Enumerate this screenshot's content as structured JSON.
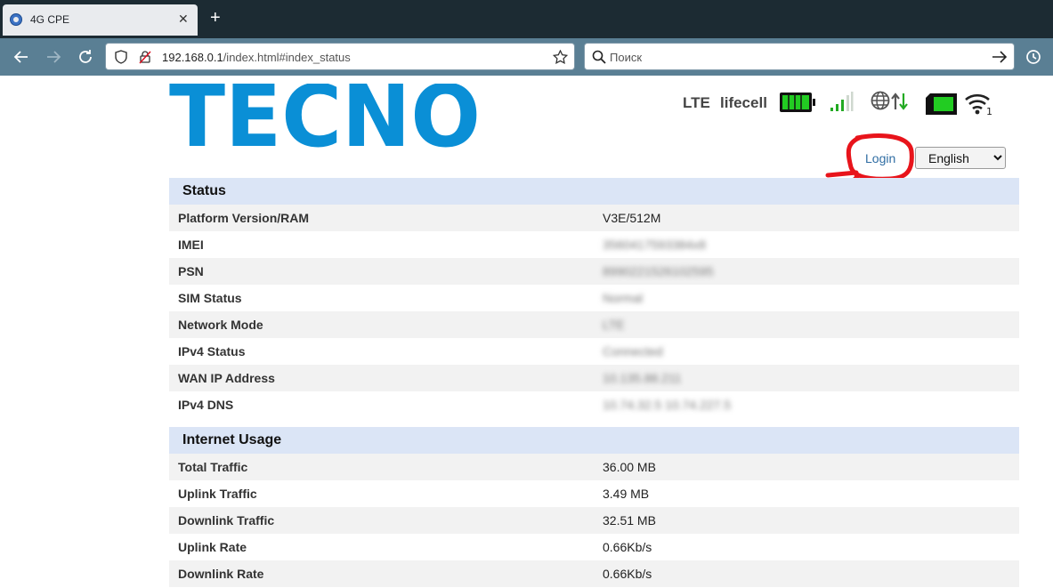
{
  "browser": {
    "tab_title": "4G CPE",
    "url_host": "192.168.0.1",
    "url_path": "/index.html#index_status",
    "search_placeholder": "Поиск"
  },
  "header": {
    "brand": "TECNO",
    "network_type": "LTE",
    "operator": "lifecell",
    "wifi_clients": "1",
    "colors": {
      "brand_blue": "#0a8fd6",
      "battery_green": "#22cc22"
    }
  },
  "controls": {
    "login_label": "Login",
    "language": "English"
  },
  "status": {
    "title": "Status",
    "rows": [
      {
        "label": "Platform Version/RAM",
        "value": "V3E/512M"
      },
      {
        "label": "IMEI",
        "value": "3560417593384x8"
      },
      {
        "label": "PSN",
        "value": "8990221526102595"
      },
      {
        "label": "SIM Status",
        "value": "Normal"
      },
      {
        "label": "Network Mode",
        "value": "LTE"
      },
      {
        "label": "IPv4 Status",
        "value": "Connected"
      },
      {
        "label": "WAN IP Address",
        "value": "10.135.88.211"
      },
      {
        "label": "IPv4 DNS",
        "value": "10.74.32.5 10.74.227.5"
      }
    ]
  },
  "usage": {
    "title": "Internet Usage",
    "rows": [
      {
        "label": "Total Traffic",
        "value": "36.00 MB"
      },
      {
        "label": "Uplink Traffic",
        "value": "3.49 MB"
      },
      {
        "label": "Downlink Traffic",
        "value": "32.51 MB"
      },
      {
        "label": "Uplink Rate",
        "value": "0.66Kb/s"
      },
      {
        "label": "Downlink Rate",
        "value": "0.66Kb/s"
      }
    ]
  }
}
